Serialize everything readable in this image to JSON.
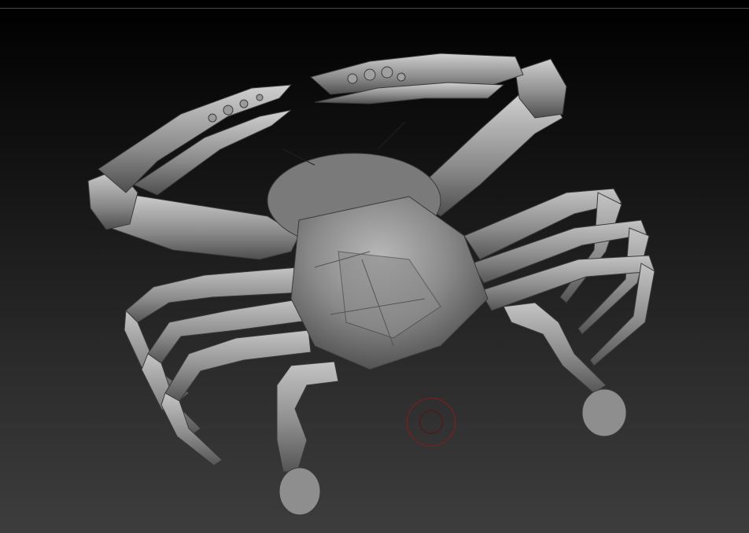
{
  "viewport": {
    "background_top": "#000000",
    "background_bottom": "#3d3d3d",
    "material_color": "#8f8f8f"
  },
  "model": {
    "subject": "crab-sculpt"
  },
  "cursor": {
    "icon": "brush-cursor-icon",
    "outer_color": "#8a1a1a",
    "inner_color": "#5a1010"
  }
}
